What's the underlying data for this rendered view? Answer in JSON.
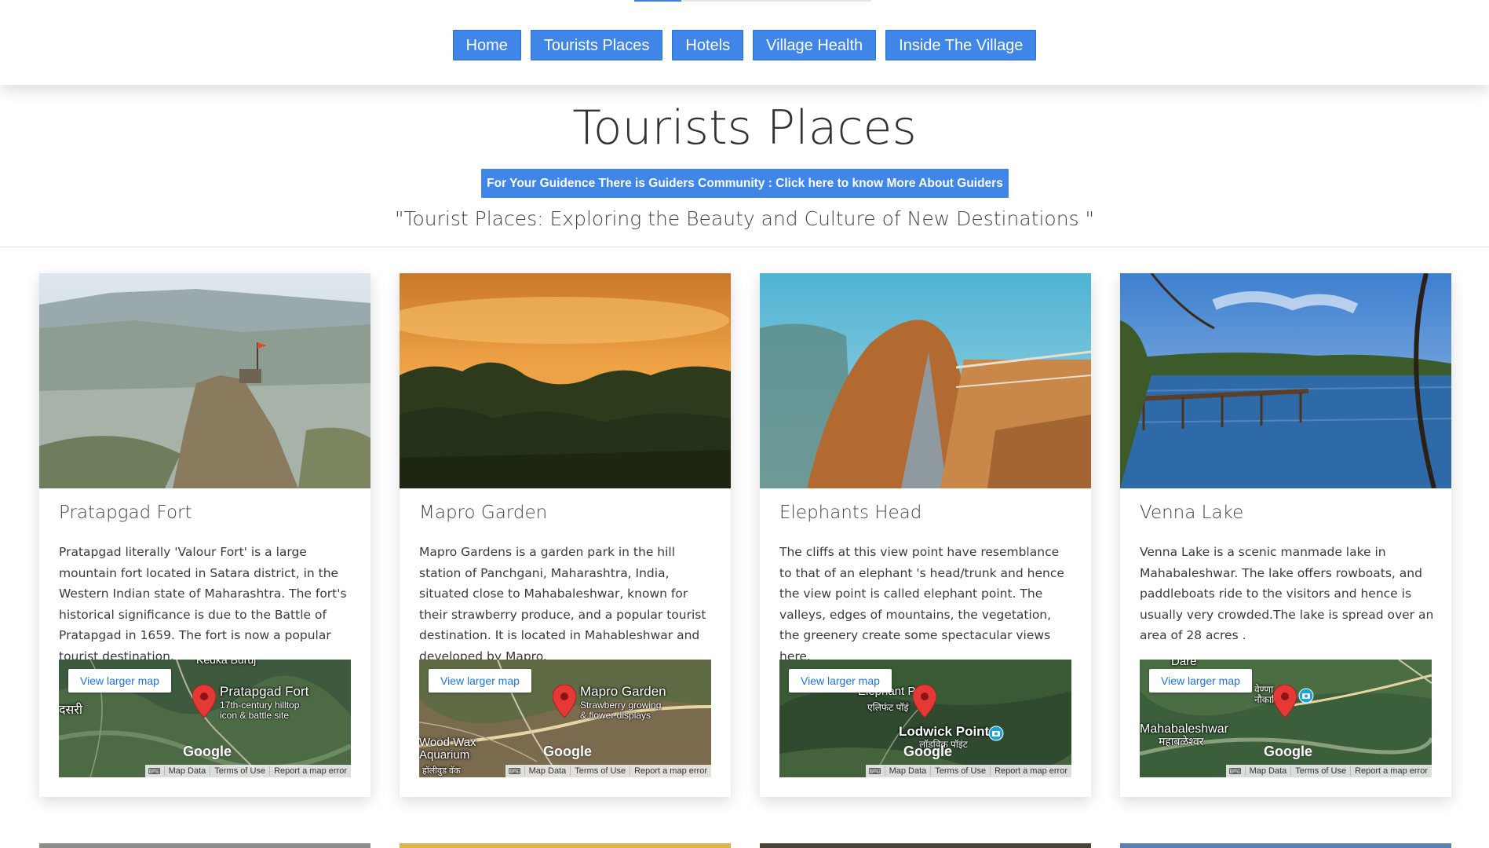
{
  "nav": {
    "items": [
      "Home",
      "Tourists Places",
      "Hotels",
      "Village Health",
      "Inside The Village"
    ]
  },
  "header": {
    "title": "Tourists Places",
    "guide_button": "For Your Guidence There is Guiders Community : Click here to know More About Guiders",
    "tagline": "\"Tourist Places: Exploring the Beauty and Culture of New Destinations \""
  },
  "map_common": {
    "view_larger": "View larger map",
    "google": "Google",
    "map_data": "Map Data",
    "terms": "Terms of Use",
    "report": "Report a map error"
  },
  "cards": [
    {
      "title": "Pratapgad Fort",
      "text": "Pratapgad literally 'Valour Fort' is a large mountain fort located in Satara district, in the Western Indian state of Maharashtra. The fort's historical significance is due to the Battle of Pratapgad in 1659. The fort is now a popular tourist destination.",
      "map_place": "Pratapgad Fort",
      "map_sub": "17th-century hilltop\nicon & battle site",
      "map_extra_1": "दसरी",
      "map_extra_2": "Kedka Buruj"
    },
    {
      "title": "Mapro Garden",
      "text": "Mapro Gardens is a garden park in the hill station of Panchgani, Maharashtra, India, situated close to Mahabaleshwar, known for their strawberry produce, and a popular tourist destination. It is located in Mahableshwar and developed by Mapro.",
      "map_place": "Mapro Garden",
      "map_sub": "Strawberry growing\n& flower displays",
      "map_extra_1": "Wood Wax\nAquarium",
      "map_extra_2": "हॉलीवुड वॅक"
    },
    {
      "title": "Elephants Head",
      "text": "The cliffs at this view point have resemblance to that of an elephant 's head/trunk and hence the view point is called elephant point. The valleys, edges of mountains, the vegetation, the greenery create some spectacular views here.",
      "map_place": "Lodwick Point",
      "map_sub": "लॉडविक पॉइंट",
      "map_extra_1": "Elephant Poin",
      "map_extra_2": "एलिफंट पॉइं"
    },
    {
      "title": "Venna Lake",
      "text": "Venna Lake is a scenic manmade lake in Mahabaleshwar. The lake offers rowboats, and paddleboats ride to the visitors and hence is usually very crowded.The lake is spread over an area of 28 acres .",
      "map_place": "Mahabaleshwar",
      "map_sub": "महाबळेश्वर",
      "map_extra_1": "Dare",
      "map_extra_2": "वेण्णा\nनौकाविहार"
    }
  ],
  "colors": {
    "accent": "#3f86e8",
    "marker": "#e53935",
    "card_bg": "#ffffff"
  }
}
